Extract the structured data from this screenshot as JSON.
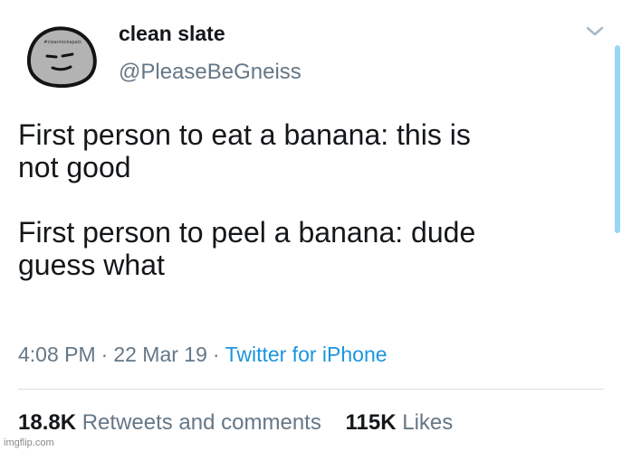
{
  "author": {
    "display_name": "clean slate",
    "handle": "@PleaseBeGneiss",
    "avatar_icon": "rock-face-avatar",
    "avatar_text": "#cleanrockapals"
  },
  "tweet": {
    "paragraphs": [
      "First person to eat a banana: this is\nnot good",
      "First person to peel a banana: dude\nguess what"
    ],
    "time": "4:08 PM",
    "date": "22 Mar 19",
    "source": "Twitter for iPhone",
    "separator": "·"
  },
  "stats": {
    "retweets_count": "18.8K",
    "retweets_label": "Retweets and comments",
    "likes_count": "115K",
    "likes_label": "Likes"
  },
  "watermark": "imgflip.com",
  "colors": {
    "text": "#14171a",
    "secondary": "#657786",
    "link": "#1b95e0",
    "divider": "#d8dde1"
  }
}
